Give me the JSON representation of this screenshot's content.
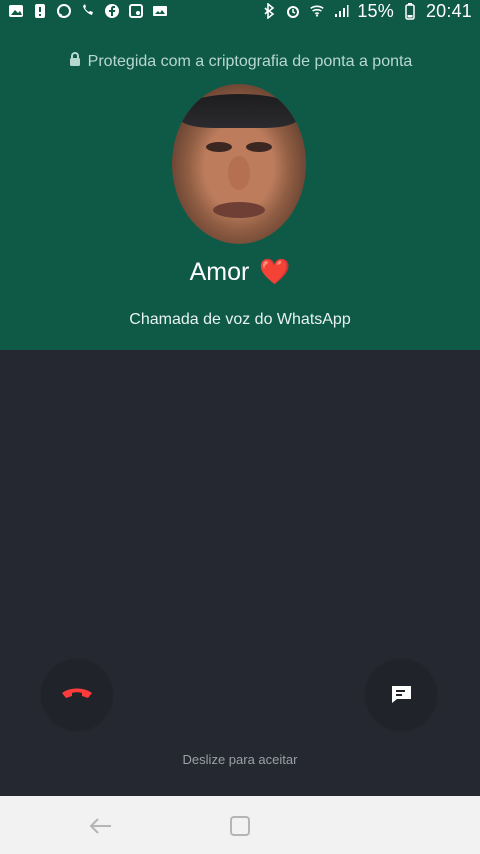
{
  "status_bar": {
    "battery_percent": "15%",
    "time": "20:41",
    "icons_left": [
      "image-icon",
      "warning-icon",
      "whatsapp-icon",
      "missed-call-icon",
      "facebook-icon",
      "media-icon",
      "gallery-icon"
    ],
    "icons_right": [
      "bluetooth-icon",
      "alarm-icon",
      "wifi-icon",
      "signal-icon",
      "battery-icon"
    ]
  },
  "call_header": {
    "encryption_text": "Protegida com a criptografia de ponta a ponta",
    "contact_name": "Amor",
    "contact_emoji": "❤️",
    "call_type": "Chamada de voz do WhatsApp"
  },
  "actions": {
    "swipe_hint": "Deslize para aceitar"
  },
  "colors": {
    "header_bg": "#0f5a47",
    "body_bg": "#252830",
    "decline_icon": "#ff3b3b",
    "message_icon": "#ffffff"
  }
}
